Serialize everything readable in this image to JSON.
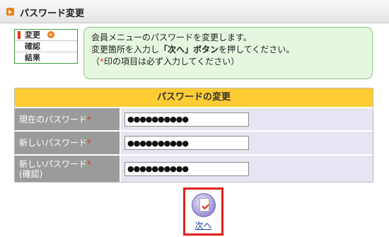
{
  "header": {
    "title": "パスワード変更"
  },
  "steps": [
    {
      "label": "変更",
      "active": true
    },
    {
      "label": "確認",
      "active": false
    },
    {
      "label": "結果",
      "active": false
    }
  ],
  "info": {
    "line1": "会員メニューのパスワードを変更します。",
    "line2_pre": "変更箇所を入力し",
    "line2_bold": "「次へ」ボタン",
    "line2_post": "を押してください。",
    "line3_pre": "（",
    "line3_star": "*",
    "line3_post": "印の項目は必ず入力してください）"
  },
  "form": {
    "title": "パスワードの変更",
    "rows": [
      {
        "label": "現在のパスワード",
        "required_mark": "*",
        "value": "●●●●●●●●●●"
      },
      {
        "label": "新しいパスワード",
        "required_mark": "*",
        "value": "●●●●●●●●●●"
      },
      {
        "label": "新しいパスワード",
        "label2": "(確認)",
        "required_mark": "*",
        "value": "●●●●●●●●●●"
      }
    ]
  },
  "next_button": {
    "label": "次へ"
  }
}
